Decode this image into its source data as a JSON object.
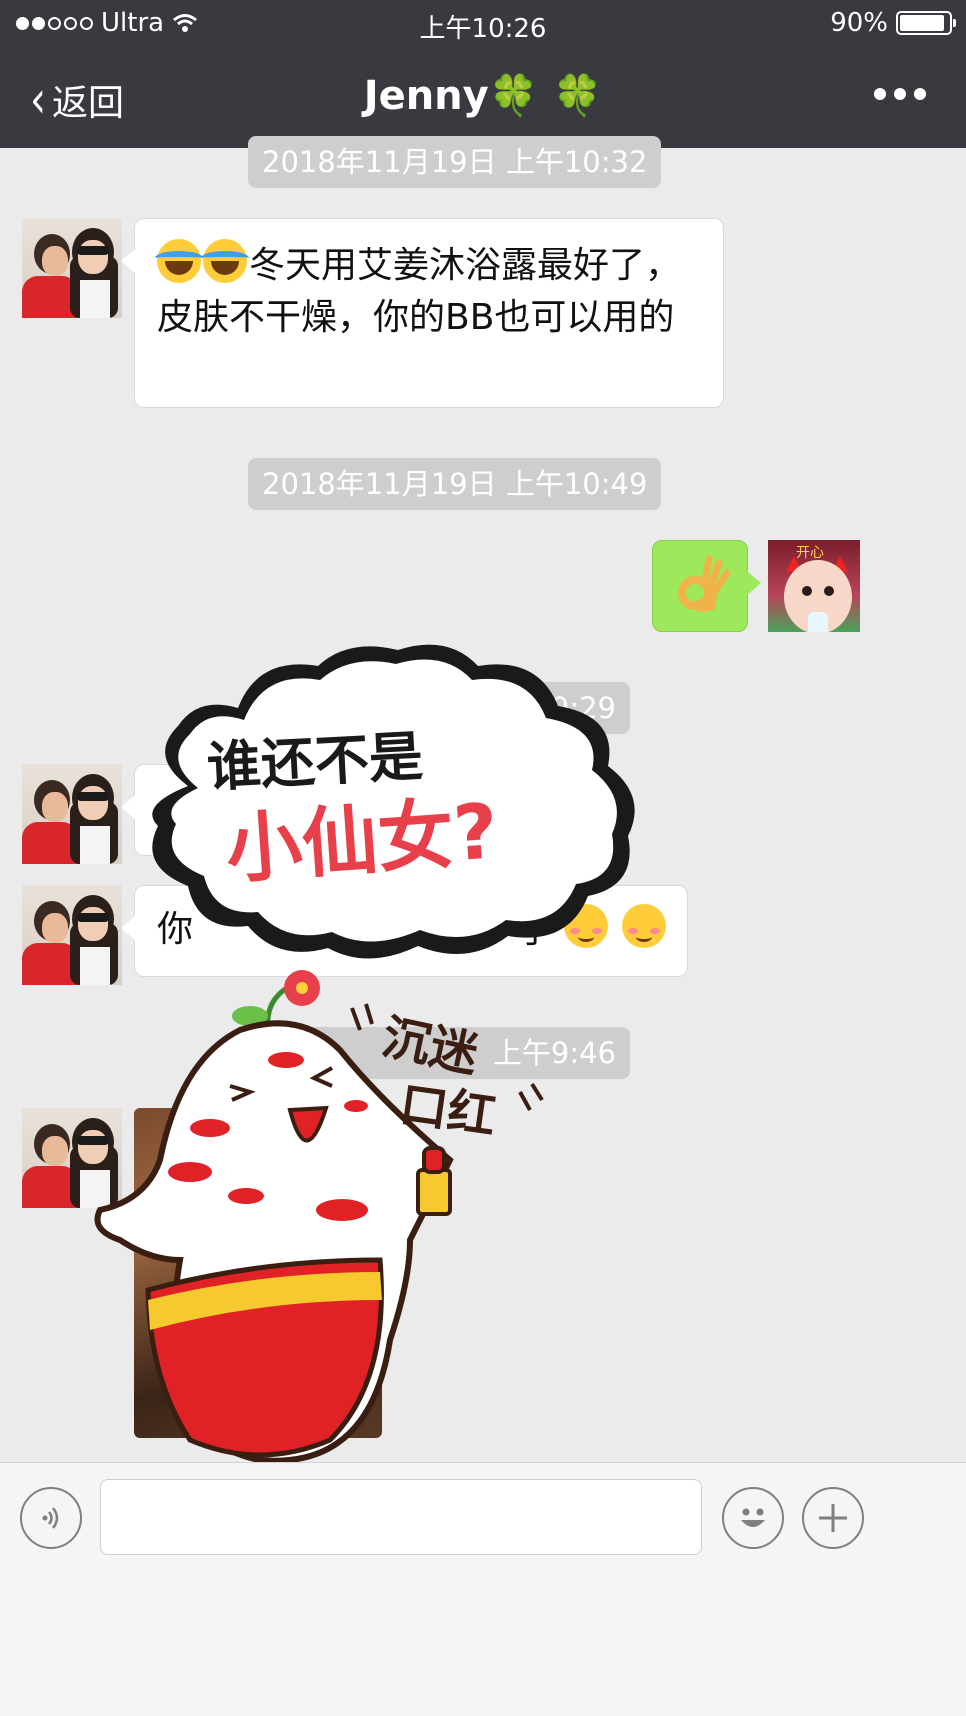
{
  "status_bar": {
    "carrier": "Ultra",
    "time": "上午10:26",
    "battery": "90%",
    "battery_level": 0.9,
    "signal_icon": "signal-dots-icon",
    "wifi_icon": "wifi-icon"
  },
  "nav": {
    "back_label": "返回",
    "title": "Jenny",
    "title_emoji": "🍀",
    "title_suffix": "🍀",
    "more_icon": "more-dots-icon"
  },
  "messages": {
    "ts1": "2018年11月19日 上午10:32",
    "msg1_text": "冬天用艾姜沐浴露最好了，皮肤不干燥，你的BB也可以用的",
    "ts2": "2018年11月19日 上午10:49",
    "msg2_icon": "ok-hand-emoji",
    "ts3": "9:29",
    "msg4_visible": "你",
    "msg4_tail": "了",
    "ts4_visible": "上午9:46"
  },
  "stickers": {
    "cloud_line1": "谁还不是",
    "cloud_line2": "小仙女?",
    "radish_text1": "沉迷",
    "radish_text2": "口红"
  },
  "input_bar": {
    "voice_icon": "voice-icon",
    "input_value": "",
    "emoji_icon": "emoji-face-icon",
    "plus_icon": "plus-icon"
  },
  "colors": {
    "nav_bg": "#393a3f",
    "chat_bg": "#ebebeb",
    "sent_bubble": "#9ee85b",
    "time_pill": "#cecece"
  }
}
